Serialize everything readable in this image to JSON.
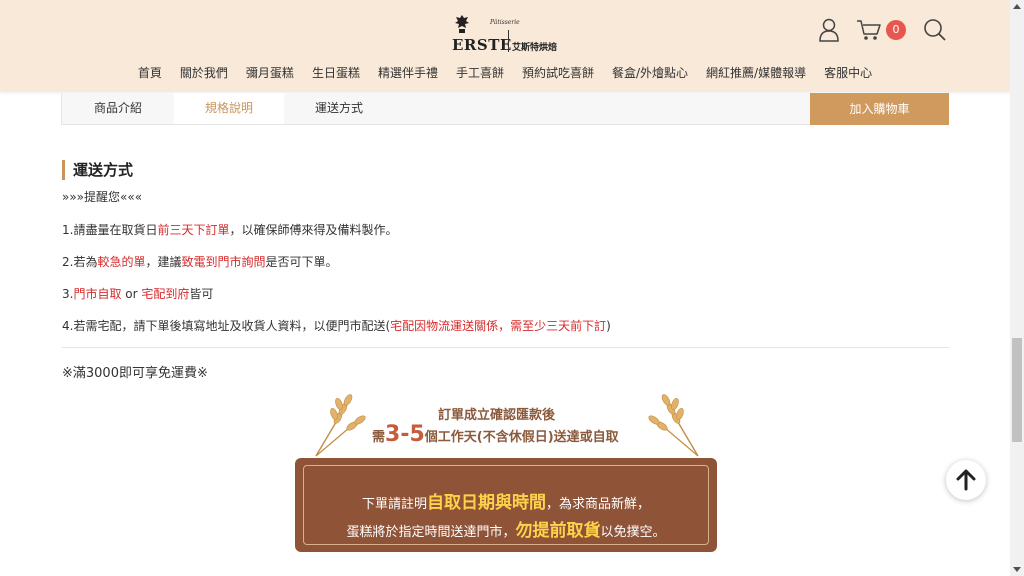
{
  "header": {
    "logo": {
      "script_text": "Pâtisserie",
      "brand": "ERSTE",
      "chinese_name": "艾斯特烘焙"
    },
    "cart_count": "0",
    "icons": [
      "user-icon",
      "cart-icon",
      "search-icon"
    ],
    "nav": [
      "首頁",
      "關於我們",
      "彌月蛋糕",
      "生日蛋糕",
      "精選伴手禮",
      "手工喜餅",
      "預約試吃喜餅",
      "餐盒/外燴點心",
      "網紅推薦/媒體報導",
      "客服中心"
    ]
  },
  "tabs": {
    "items": [
      "商品介紹",
      "規格說明",
      "運送方式"
    ],
    "active": "規格說明",
    "add_to_cart": "加入購物車"
  },
  "content": {
    "section_title": "運送方式",
    "reminder": "»»»提醒您«««",
    "lines": [
      {
        "parts": [
          {
            "t": "1.請盡量在取貨日",
            "c": "n"
          },
          {
            "t": "前三天下訂單",
            "c": "r"
          },
          {
            "t": "，以確保師傅來得及備料製作。",
            "c": "n"
          }
        ]
      },
      {
        "parts": [
          {
            "t": "2.若為",
            "c": "n"
          },
          {
            "t": "較急的單",
            "c": "r"
          },
          {
            "t": "，建議",
            "c": "n"
          },
          {
            "t": "致電到門市詢問",
            "c": "r"
          },
          {
            "t": "是否可下單。",
            "c": "n"
          }
        ]
      },
      {
        "parts": [
          {
            "t": "3.",
            "c": "n"
          },
          {
            "t": "門市自取",
            "c": "r"
          },
          {
            "t": " or ",
            "c": "n"
          },
          {
            "t": "宅配到府",
            "c": "r"
          },
          {
            "t": "皆可",
            "c": "n"
          }
        ]
      },
      {
        "parts": [
          {
            "t": "4.若需宅配，請下單後填寫地址及收貨人資料，以便門市配送(",
            "c": "n"
          },
          {
            "t": "宅配因物流運送關係，需至少三天前下訂",
            "c": "r"
          },
          {
            "t": ")",
            "c": "n"
          }
        ]
      }
    ],
    "free_shipping": "※滿3000即可享免運費※"
  },
  "banner": {
    "top_line1": "訂單成立確認匯款後",
    "top_line2_pre": "需",
    "top_line2_big": "3-5",
    "top_line2_post": "個工作天(不含休假日)送達或自取",
    "box_line1_pre": "下單請註明",
    "box_line1_hl": "自取日期與時間",
    "box_line1_post": "，為求商品新鮮，",
    "box_line2_pre": "蛋糕將於指定時間送達門市，",
    "box_line2_hl": "勿提前取貨",
    "box_line2_post": "以免撲空。"
  },
  "colors": {
    "header_bg": "#f9e9d9",
    "accent": "#c8945a",
    "add_to_cart_bg": "#d09a5e",
    "highlight_red": "#d62b2b",
    "banner_bg": "#8f5338",
    "banner_highlight": "#ffd24a",
    "badge": "#e8574e"
  }
}
